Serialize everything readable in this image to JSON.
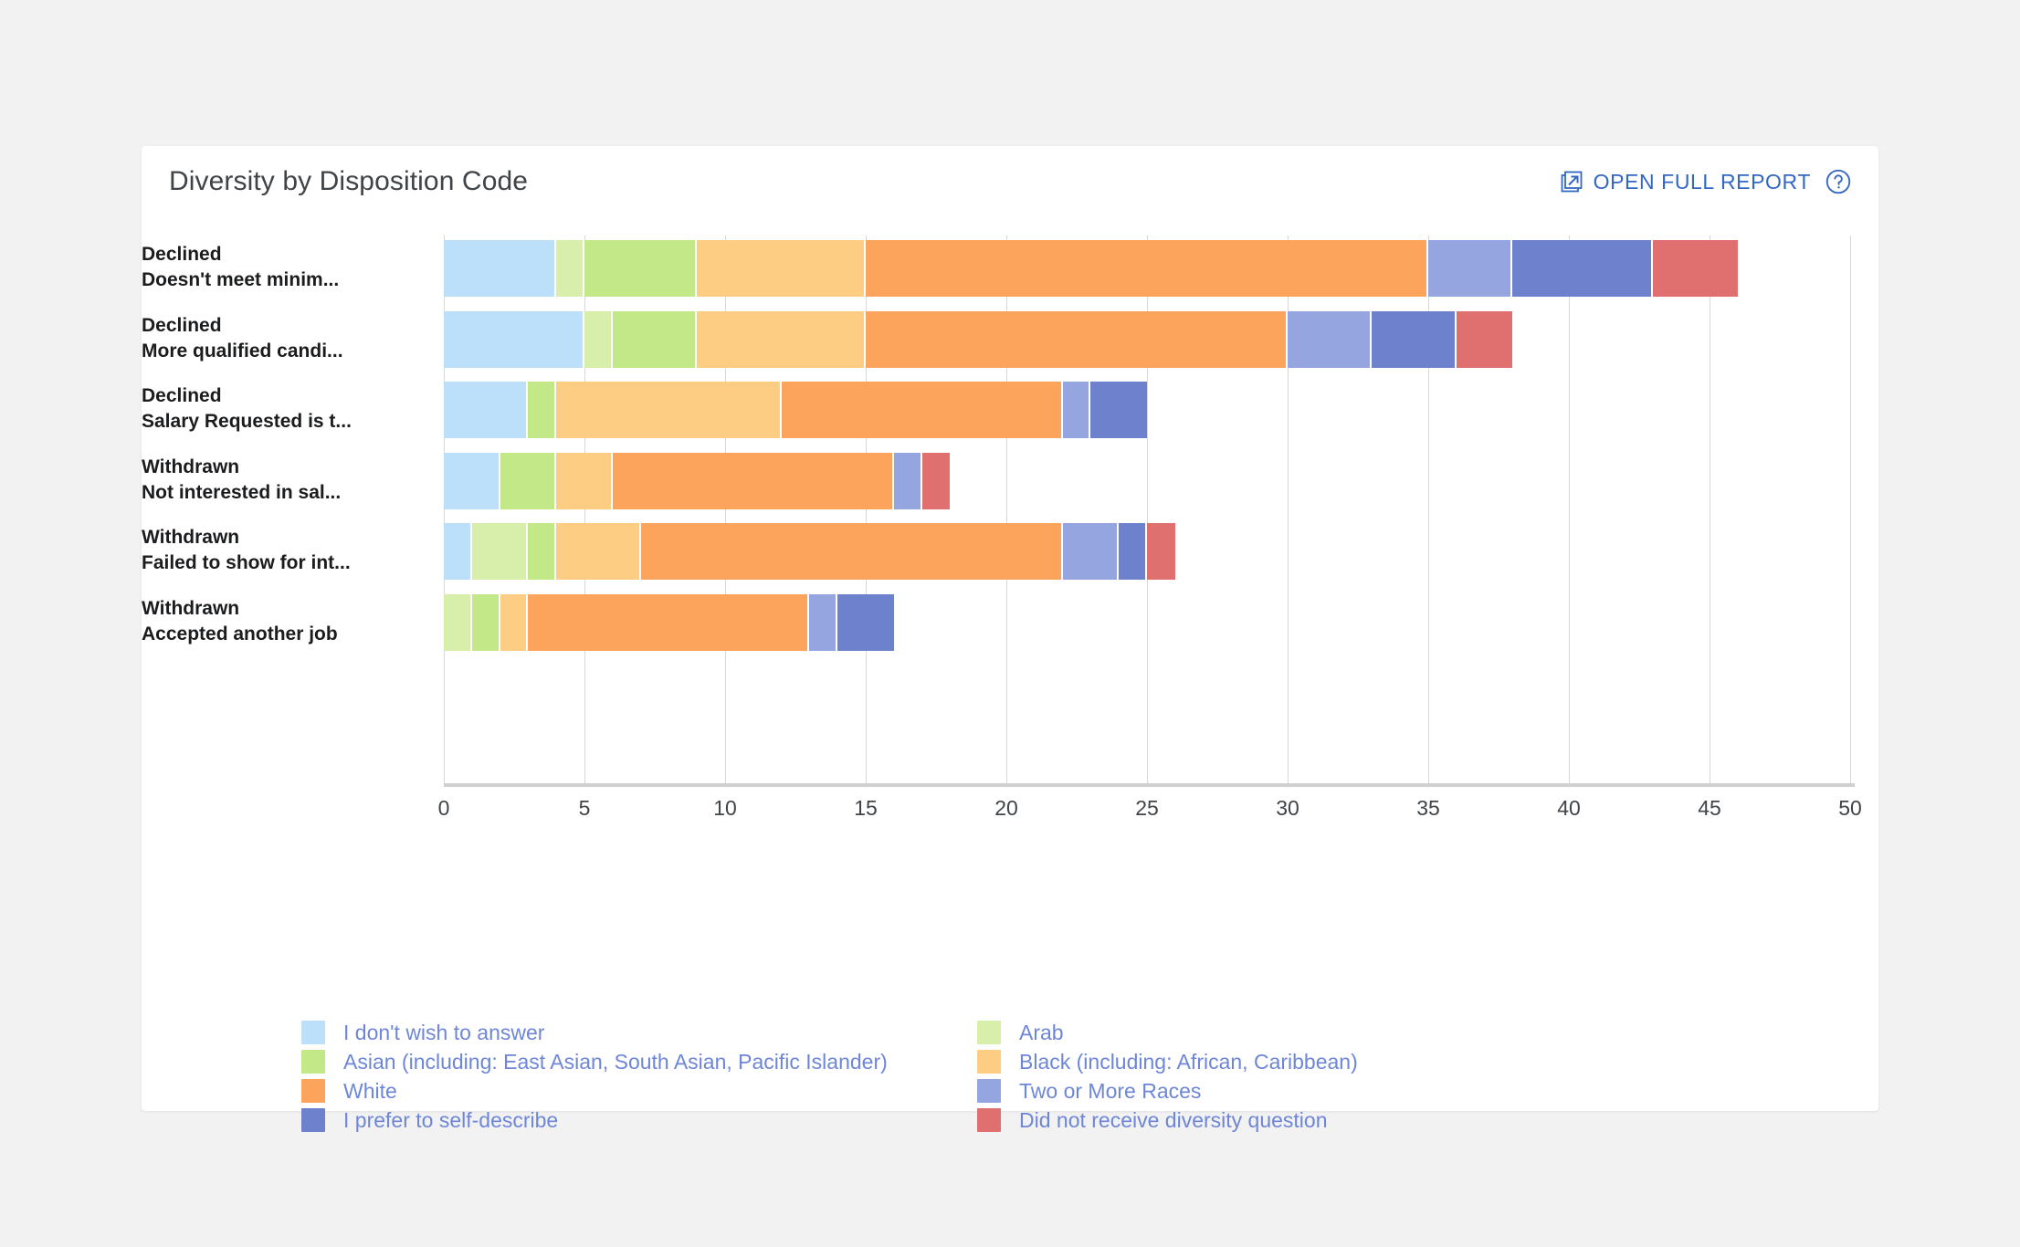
{
  "header": {
    "title": "Diversity by Disposition Code",
    "open_report_label": "OPEN FULL REPORT",
    "ext_icon": "external-link-icon",
    "help_icon": "question-mark-circle-icon"
  },
  "colors": {
    "no_answer": "#bce0fa",
    "arab": "#d8eeab",
    "asian": "#c3e887",
    "black": "#fdcd84",
    "white": "#fda45c",
    "two_or_more": "#94a5df",
    "self_describe": "#6d81cd",
    "no_question": "#e0706f",
    "link": "#3267c4",
    "legend_text": "#6e86d8",
    "grid": "#d8d8d8",
    "title_text": "#3f4448",
    "category_text": "#1b1c1e",
    "card_bg": "#ffffff",
    "page_bg": "#f2f2f2"
  },
  "chart_data": {
    "type": "bar",
    "orientation": "horizontal",
    "stacked": true,
    "title": "Diversity by Disposition Code",
    "xlabel": "",
    "ylabel": "",
    "xlim": [
      0,
      50
    ],
    "xticks": [
      0,
      5,
      10,
      15,
      20,
      25,
      30,
      35,
      40,
      45,
      50
    ],
    "xtick_labels": [
      "0",
      "5",
      "10",
      "15",
      "20",
      "25",
      "30",
      "35",
      "40",
      "45",
      "50"
    ],
    "grid": true,
    "legend_position": "bottom",
    "categories": [
      {
        "line1": "Declined",
        "line2": "Doesn't meet minim..."
      },
      {
        "line1": "Declined",
        "line2": "More qualified candi..."
      },
      {
        "line1": "Declined",
        "line2": "Salary Requested is t..."
      },
      {
        "line1": "Withdrawn",
        "line2": "Not interested in sal..."
      },
      {
        "line1": "Withdrawn",
        "line2": "Failed to show for int..."
      },
      {
        "line1": "Withdrawn",
        "line2": "Accepted another job"
      }
    ],
    "series": [
      {
        "name": "I don't wish to answer",
        "color": "#bce0fa",
        "values": [
          4,
          5,
          3,
          2,
          1,
          0
        ]
      },
      {
        "name": "Arab",
        "color": "#d8eeab",
        "values": [
          1,
          1,
          0,
          0,
          2,
          1
        ]
      },
      {
        "name": "Asian (including: East Asian, South Asian, Pacific Islander)",
        "color": "#c3e887",
        "values": [
          4,
          3,
          1,
          2,
          1,
          1
        ]
      },
      {
        "name": "Black (including: African, Caribbean)",
        "color": "#fdcd84",
        "values": [
          6,
          6,
          8,
          2,
          3,
          1
        ]
      },
      {
        "name": "White",
        "color": "#fda45c",
        "values": [
          20,
          15,
          10,
          10,
          15,
          10
        ]
      },
      {
        "name": "Two or More Races",
        "color": "#94a5df",
        "values": [
          3,
          3,
          1,
          1,
          2,
          1
        ]
      },
      {
        "name": "I prefer to self-describe",
        "color": "#6d81cd",
        "values": [
          5,
          3,
          2,
          0,
          1,
          2
        ]
      },
      {
        "name": "Did not receive diversity question",
        "color": "#e0706f",
        "values": [
          3,
          2,
          0,
          1,
          1,
          0
        ]
      }
    ],
    "totals": [
      46,
      38,
      25,
      18,
      26,
      16
    ]
  },
  "legend": [
    {
      "label": "I don't wish to answer",
      "color": "#bce0fa"
    },
    {
      "label": "Arab",
      "color": "#d8eeab"
    },
    {
      "label": "Asian (including: East Asian, South Asian, Pacific Islander)",
      "color": "#c3e887"
    },
    {
      "label": "Black (including: African, Caribbean)",
      "color": "#fdcd84"
    },
    {
      "label": "White",
      "color": "#fda45c"
    },
    {
      "label": "Two or More Races",
      "color": "#94a5df"
    },
    {
      "label": "I prefer to self-describe",
      "color": "#6d81cd"
    },
    {
      "label": "Did not receive diversity question",
      "color": "#e0706f"
    }
  ]
}
